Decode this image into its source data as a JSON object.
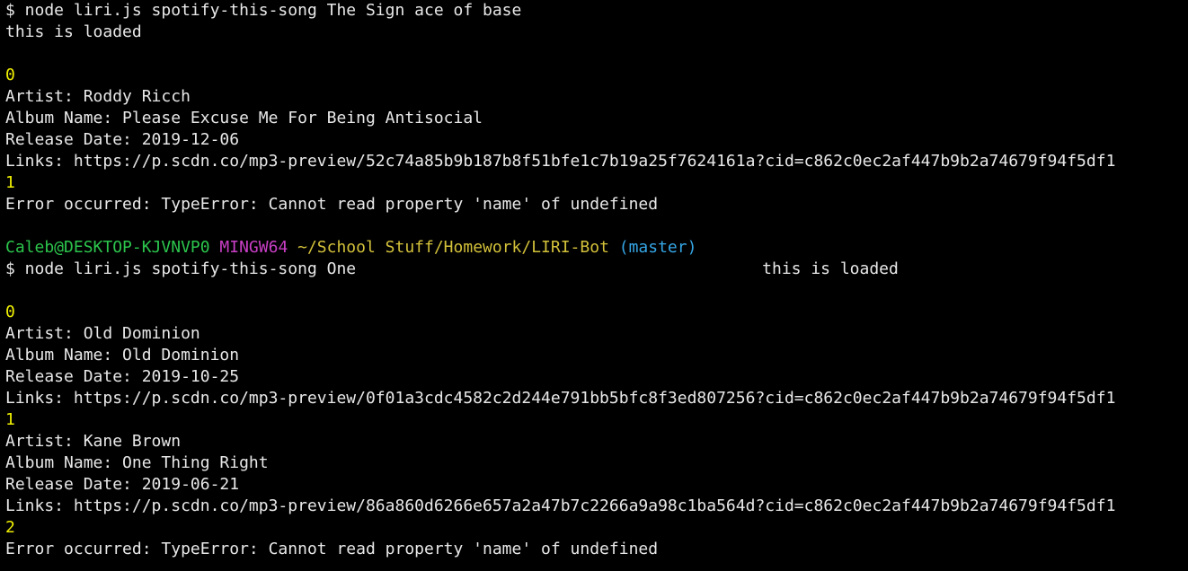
{
  "colors": {
    "background": "#000000",
    "text": "#e8e8e8",
    "index": "#f0f000",
    "user": "#2cc44c",
    "shell": "#c93fc6",
    "path": "#d3c13a",
    "branch": "#35a6e6"
  },
  "session1": {
    "command": "$ node liri.js spotify-this-song The Sign ace of base",
    "loaded": "this is loaded",
    "index0": "0",
    "artist0": "Artist: Roddy Ricch",
    "album0": "Album Name: Please Excuse Me For Being Antisocial",
    "release0": "Release Date: 2019-12-06",
    "links0": "Links: https://p.scdn.co/mp3-preview/52c74a85b9b187b8f51bfe1c7b19a25f7624161a?cid=c862c0ec2af447b9b2a74679f94f5df1",
    "index1": "1",
    "error": "Error occurred: TypeError: Cannot read property 'name' of undefined"
  },
  "prompt": {
    "user_host": "Caleb@DESKTOP-KJVNVP0",
    "shell": "MINGW64",
    "path": "~/School Stuff/Homework/LIRI-Bot",
    "branch": "(master)"
  },
  "session2": {
    "command": "$ node liri.js spotify-this-song One",
    "loaded": "this is loaded",
    "index0": "0",
    "artist0": "Artist: Old Dominion",
    "album0": "Album Name: Old Dominion",
    "release0": "Release Date: 2019-10-25",
    "links0": "Links: https://p.scdn.co/mp3-preview/0f01a3cdc4582c2d244e791bb5bfc8f3ed807256?cid=c862c0ec2af447b9b2a74679f94f5df1",
    "index1": "1",
    "artist1": "Artist: Kane Brown",
    "album1": "Album Name: One Thing Right",
    "release1": "Release Date: 2019-06-21",
    "links1": "Links: https://p.scdn.co/mp3-preview/86a860d6266e657a2a47b7c2266a9a98c1ba564d?cid=c862c0ec2af447b9b2a74679f94f5df1",
    "index2": "2",
    "error": "Error occurred: TypeError: Cannot read property 'name' of undefined"
  }
}
